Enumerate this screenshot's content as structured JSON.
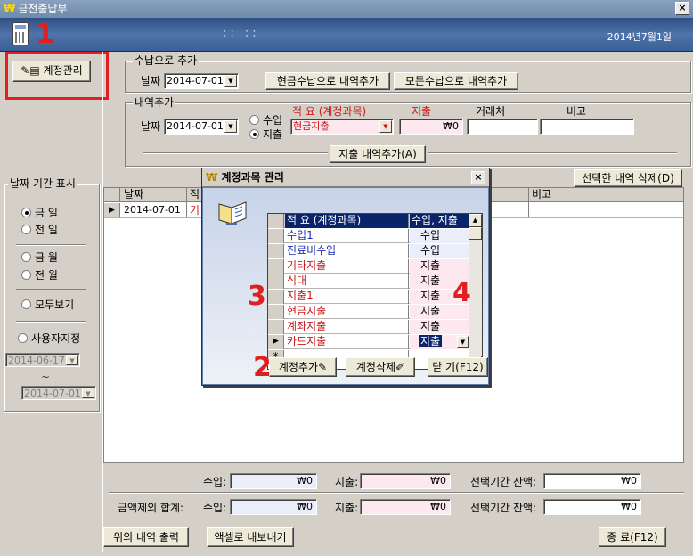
{
  "window": {
    "icon": "₩",
    "title": "금전출납부",
    "close": "×"
  },
  "header": {
    "dots": ":: ::",
    "date": "2014년7월1일"
  },
  "annotations": [
    "1",
    "2",
    "3",
    "4"
  ],
  "buttons": {
    "account_manage": "계정관리",
    "cash_add": "현금수납으로 내역추가",
    "all_add": "모든수납으로 내역추가",
    "expense_add": "지출 내역추가(A)",
    "delete_selected": "선택한 내역 삭제(D)",
    "print": "위의 내역 출력",
    "export_excel": "액셀로 내보내기",
    "exit": "종 료(F12)"
  },
  "receipt_group": {
    "label": "수납으로 추가",
    "date_label": "날짜",
    "date": "2014-07-01"
  },
  "entry_group": {
    "label": "내역추가",
    "date_label": "날짜",
    "date": "2014-07-01",
    "radio_income": "수입",
    "radio_expense": "지출",
    "col_summary": "적 요 (계정과목)",
    "col_expense": "지출",
    "col_vendor": "거래처",
    "col_note": "비고",
    "summary_value": "현금지출",
    "amount_value": "₩0"
  },
  "period": {
    "label": "날짜 기간 표시",
    "options": [
      "금 일",
      "전 일",
      "금 월",
      "전 월",
      "모두보기",
      "사용자지정"
    ],
    "from": "2014-06-17",
    "tilde": "~",
    "to": "2014-07-01"
  },
  "main_grid": {
    "headers": [
      "날짜",
      "적",
      "비고"
    ],
    "row": {
      "date": "2014-07-01",
      "partial": "기"
    }
  },
  "totals": {
    "income_label": "수입:",
    "expense_label": "지출:",
    "balance_label": "선택기간 잔액:",
    "excl_label": "금액제외 합계:",
    "row1": {
      "income": "₩0",
      "expense": "₩0",
      "balance": "₩0"
    },
    "row2": {
      "income": "₩0",
      "expense": "₩0",
      "balance": "₩0"
    }
  },
  "dialog": {
    "icon": "₩",
    "title": "계정과목 관리",
    "close": "×",
    "col_summary": "적 요 (계정과목)",
    "col_type": "수입, 지출",
    "rows": [
      {
        "name": "수입1",
        "type": "수입"
      },
      {
        "name": "진료비수입",
        "type": "수입"
      },
      {
        "name": "기타지출",
        "type": "지출"
      },
      {
        "name": "식대",
        "type": "지출"
      },
      {
        "name": "지출1",
        "type": "지출"
      },
      {
        "name": "현금지출",
        "type": "지출"
      },
      {
        "name": "계좌지출",
        "type": "지출"
      },
      {
        "name": "카드지출",
        "type": "지출"
      }
    ],
    "new_row_marker": "*",
    "add_button": "계정추가",
    "delete_button": "계정삭제",
    "close_button": "닫 기(F12)"
  },
  "colors": {
    "income": "#1c2fb0",
    "expense": "#c41818",
    "annotation": "#e02020",
    "header": "#3a6099"
  }
}
